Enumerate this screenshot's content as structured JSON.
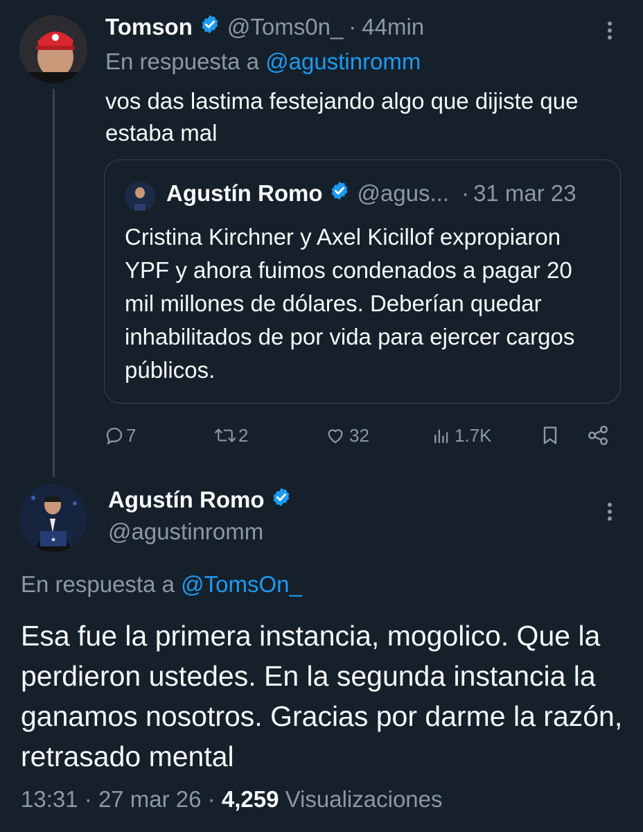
{
  "tweet1": {
    "author_name": "Tomson",
    "author_handle": "@Toms0n_",
    "separator": "·",
    "time": "44min",
    "reply_prefix": "En respuesta a",
    "reply_to": "@agustinromm",
    "text": "vos das lastima festejando algo que dijiste que estaba mal",
    "actions": {
      "replies": "7",
      "retweets": "2",
      "likes": "32",
      "views": "1.7K"
    }
  },
  "quoted": {
    "author_name": "Agustín Romo",
    "author_handle": "@agus...",
    "separator": "·",
    "date": "31 mar 23",
    "text": "Cristina Kirchner y Axel Kicillof expropiaron YPF y ahora fuimos condenados a pagar 20 mil millones de dólares. Deberían quedar inhabilitados de por vida para ejercer cargos públicos."
  },
  "tweet2": {
    "author_name": "Agustín Romo",
    "author_handle": "@agustinromm",
    "reply_prefix": "En respuesta a",
    "reply_to": "@TomsOn_",
    "text": "Esa fue la primera instancia, mogolico. Que la perdieron ustedes. En la segunda instancia la ganamos nosotros. Gracias por darme la razón, retrasado mental",
    "time": "13:31",
    "date": "27 mar 26",
    "separator": "·",
    "views_count": "4,259",
    "views_label": "Visualizaciones"
  },
  "icons": {
    "verified": "verified-badge-icon",
    "more": "more-options-icon",
    "reply": "reply-icon",
    "retweet": "retweet-icon",
    "like": "heart-icon",
    "views": "views-icon",
    "bookmark": "bookmark-icon",
    "share": "share-icon"
  },
  "colors": {
    "background": "#15202b",
    "text": "#f7f9f9",
    "muted": "#8b98a5",
    "accent": "#1d9bf0",
    "border": "#38444d"
  }
}
